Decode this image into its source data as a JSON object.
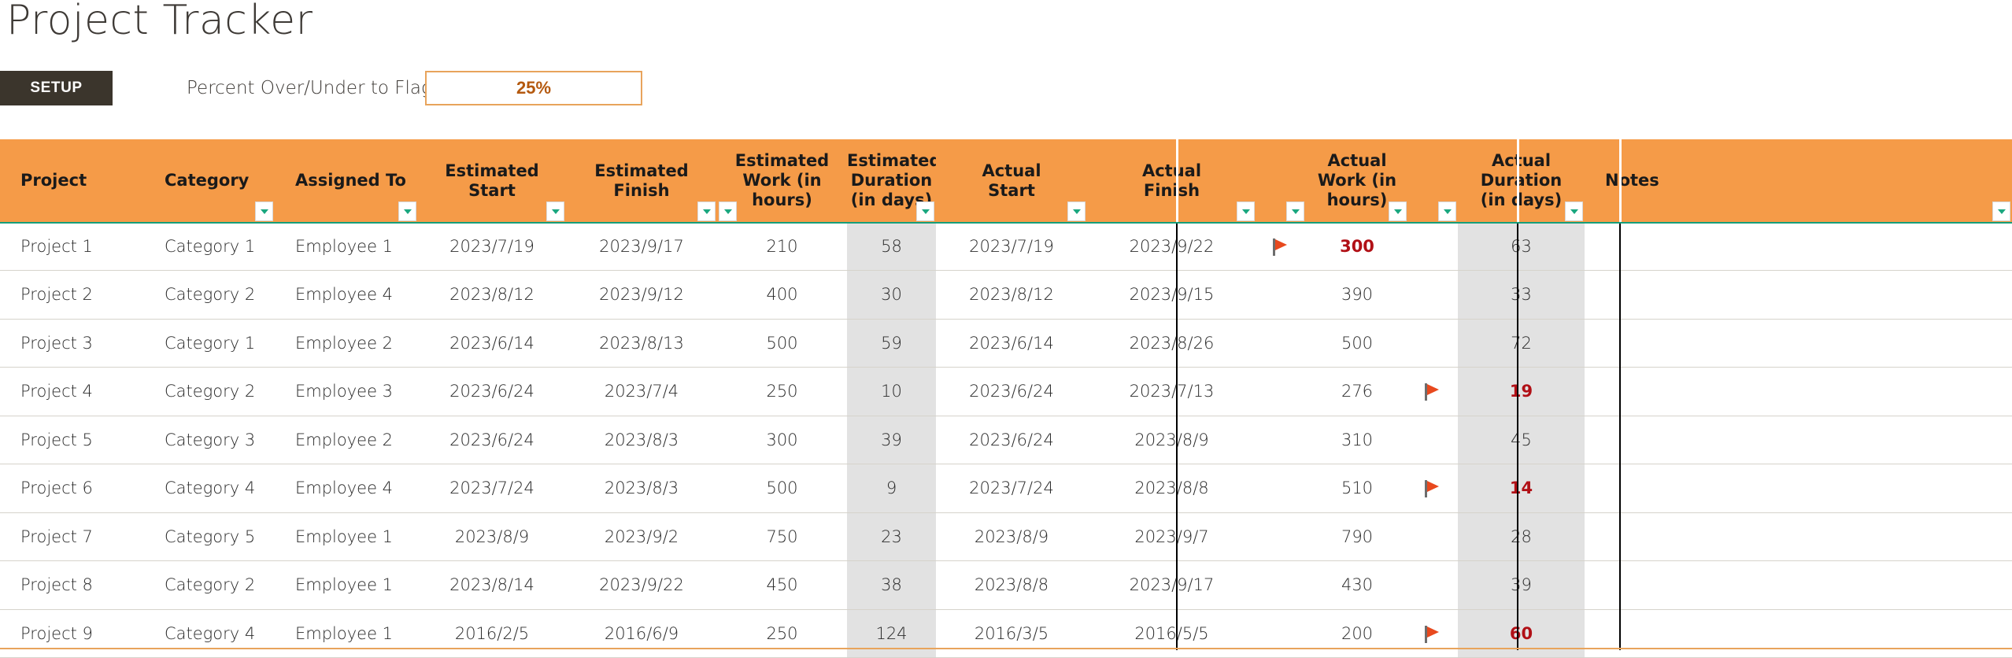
{
  "page_title": "Project Tracker",
  "setup": {
    "badge_label": "SETUP",
    "flag_label": "Percent Over/Under to Flag",
    "flag_value": "25%"
  },
  "colors": {
    "header_orange": "#F59B48",
    "setup_dark": "#3B352C",
    "accent_orange": "#E8A45C",
    "percent_text": "#B4590F",
    "over_red": "#B11016",
    "flag_orange": "#E8491E",
    "shaded_cell": "#E2E2E2",
    "filter_arrow_green": "#1AA77F",
    "header_underline_green": "#169E7A"
  },
  "columns": [
    {
      "key": "project",
      "label": "Project",
      "align": "left",
      "filter": false
    },
    {
      "key": "category",
      "label": "Category",
      "align": "left",
      "filter": true
    },
    {
      "key": "assigned_to",
      "label": "Assigned To",
      "align": "left",
      "filter": true
    },
    {
      "key": "estimated_start",
      "label": "Estimated\nStart",
      "align": "center",
      "filter": true
    },
    {
      "key": "estimated_finish",
      "label": "Estimated\nFinish",
      "align": "center",
      "filter": true
    },
    {
      "key": "estimated_work",
      "label": "Estimated\nWork (in\nhours)",
      "align": "center",
      "filter": true
    },
    {
      "key": "estimated_duration",
      "label": "Estimated\nDuration\n(in days)",
      "align": "center",
      "filter": true
    },
    {
      "key": "actual_start",
      "label": "Actual\nStart",
      "align": "center",
      "filter": true
    },
    {
      "key": "actual_finish",
      "label": "Actual\nFinish",
      "align": "center",
      "filter": true
    },
    {
      "key": "work_flag",
      "label": "",
      "align": "center",
      "filter": true
    },
    {
      "key": "actual_work",
      "label": "Actual\nWork (in\nhours)",
      "align": "center",
      "filter": true
    },
    {
      "key": "duration_flag",
      "label": "",
      "align": "center",
      "filter": true
    },
    {
      "key": "actual_duration",
      "label": "Actual\nDuration\n(in days)",
      "align": "center",
      "filter": true
    },
    {
      "key": "notes",
      "label": "Notes",
      "align": "left",
      "filter": true
    }
  ],
  "rows": [
    {
      "project": "Project 1",
      "category": "Category 1",
      "assigned_to": "Employee 1",
      "estimated_start": "2023/7/19",
      "estimated_finish": "2023/9/17",
      "estimated_work": "210",
      "estimated_duration": "58",
      "actual_start": "2023/7/19",
      "actual_finish": "2023/9/22",
      "actual_work": "300",
      "actual_duration": "63",
      "work_flagged": true,
      "duration_flagged": false,
      "notes": ""
    },
    {
      "project": "Project 2",
      "category": "Category 2",
      "assigned_to": "Employee 4",
      "estimated_start": "2023/8/12",
      "estimated_finish": "2023/9/12",
      "estimated_work": "400",
      "estimated_duration": "30",
      "actual_start": "2023/8/12",
      "actual_finish": "2023/9/15",
      "actual_work": "390",
      "actual_duration": "33",
      "work_flagged": false,
      "duration_flagged": false,
      "notes": ""
    },
    {
      "project": "Project 3",
      "category": "Category 1",
      "assigned_to": "Employee 2",
      "estimated_start": "2023/6/14",
      "estimated_finish": "2023/8/13",
      "estimated_work": "500",
      "estimated_duration": "59",
      "actual_start": "2023/6/14",
      "actual_finish": "2023/8/26",
      "actual_work": "500",
      "actual_duration": "72",
      "work_flagged": false,
      "duration_flagged": false,
      "notes": ""
    },
    {
      "project": "Project 4",
      "category": "Category 2",
      "assigned_to": "Employee 3",
      "estimated_start": "2023/6/24",
      "estimated_finish": "2023/7/4",
      "estimated_work": "250",
      "estimated_duration": "10",
      "actual_start": "2023/6/24",
      "actual_finish": "2023/7/13",
      "actual_work": "276",
      "actual_duration": "19",
      "work_flagged": false,
      "duration_flagged": true,
      "notes": ""
    },
    {
      "project": "Project 5",
      "category": "Category 3",
      "assigned_to": "Employee 2",
      "estimated_start": "2023/6/24",
      "estimated_finish": "2023/8/3",
      "estimated_work": "300",
      "estimated_duration": "39",
      "actual_start": "2023/6/24",
      "actual_finish": "2023/8/9",
      "actual_work": "310",
      "actual_duration": "45",
      "work_flagged": false,
      "duration_flagged": false,
      "notes": ""
    },
    {
      "project": "Project 6",
      "category": "Category 4",
      "assigned_to": "Employee 4",
      "estimated_start": "2023/7/24",
      "estimated_finish": "2023/8/3",
      "estimated_work": "500",
      "estimated_duration": "9",
      "actual_start": "2023/7/24",
      "actual_finish": "2023/8/8",
      "actual_work": "510",
      "actual_duration": "14",
      "work_flagged": false,
      "duration_flagged": true,
      "notes": ""
    },
    {
      "project": "Project 7",
      "category": "Category 5",
      "assigned_to": "Employee 1",
      "estimated_start": "2023/8/9",
      "estimated_finish": "2023/9/2",
      "estimated_work": "750",
      "estimated_duration": "23",
      "actual_start": "2023/8/9",
      "actual_finish": "2023/9/7",
      "actual_work": "790",
      "actual_duration": "28",
      "work_flagged": false,
      "duration_flagged": false,
      "notes": ""
    },
    {
      "project": "Project 8",
      "category": "Category 2",
      "assigned_to": "Employee 1",
      "estimated_start": "2023/8/14",
      "estimated_finish": "2023/9/22",
      "estimated_work": "450",
      "estimated_duration": "38",
      "actual_start": "2023/8/8",
      "actual_finish": "2023/9/17",
      "actual_work": "430",
      "actual_duration": "39",
      "work_flagged": false,
      "duration_flagged": false,
      "notes": ""
    },
    {
      "project": "Project 9",
      "category": "Category 4",
      "assigned_to": "Employee 1",
      "estimated_start": "2016/2/5",
      "estimated_finish": "2016/6/9",
      "estimated_work": "250",
      "estimated_duration": "124",
      "actual_start": "2016/3/5",
      "actual_finish": "2016/5/5",
      "actual_work": "200",
      "actual_duration": "60",
      "work_flagged": false,
      "duration_flagged": true,
      "notes": ""
    }
  ]
}
